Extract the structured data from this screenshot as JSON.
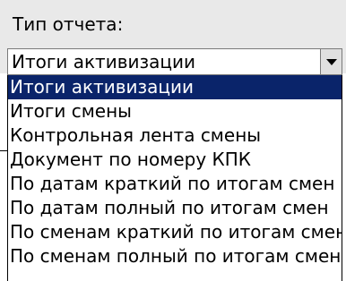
{
  "field": {
    "label": "Тип отчета:"
  },
  "combo": {
    "value": "Итоги активизации",
    "icon": "chevron-down-icon"
  },
  "list": {
    "items": [
      {
        "label": "Итоги активизации",
        "selected": true
      },
      {
        "label": "Итоги смены",
        "selected": false
      },
      {
        "label": "Контрольная лента смены",
        "selected": false
      },
      {
        "label": "Документ по номеру КПК",
        "selected": false
      },
      {
        "label": "По датам краткий по итогам смен",
        "selected": false
      },
      {
        "label": "По датам полный по итогам смен",
        "selected": false
      },
      {
        "label": "По сменам краткий по итогам смен",
        "selected": false
      },
      {
        "label": "По сменам полный по итогам смен",
        "selected": false
      }
    ]
  },
  "colors": {
    "selection_bg": "#0a246a",
    "panel_bg": "#e9e9e9"
  }
}
